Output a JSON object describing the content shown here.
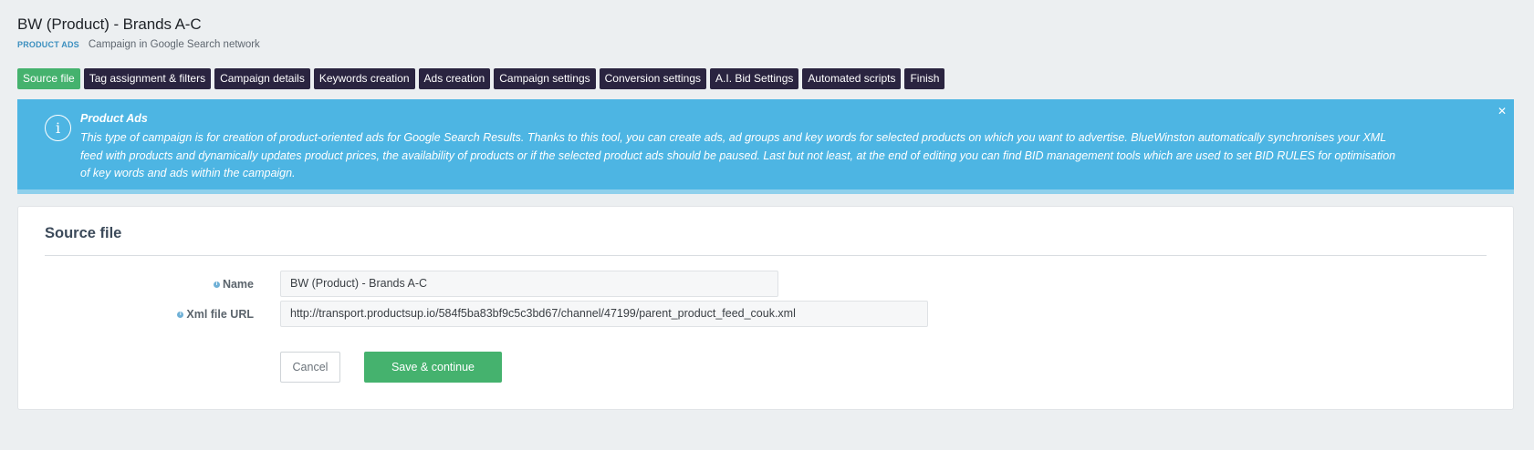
{
  "header": {
    "title": "BW (Product) - Brands A-C",
    "badge": "PRODUCT ADS",
    "subtitle": "Campaign in Google Search network"
  },
  "tabs": [
    {
      "label": "Source file",
      "active": true
    },
    {
      "label": "Tag assignment & filters"
    },
    {
      "label": "Campaign details"
    },
    {
      "label": "Keywords creation"
    },
    {
      "label": "Ads creation"
    },
    {
      "label": "Campaign settings"
    },
    {
      "label": "Conversion settings"
    },
    {
      "label": "A.I. Bid Settings"
    },
    {
      "label": "Automated scripts"
    },
    {
      "label": "Finish"
    }
  ],
  "alert": {
    "icon": "info-icon",
    "title": "Product Ads",
    "text": "This type of campaign is for creation of product-oriented ads for Google Search Results. Thanks to this tool, you can create ads, ad groups and key words for selected products on which you want to advertise. BlueWinston automatically synchronises your XML feed with products and dynamically updates product prices, the availability of products or if the selected product ads should be paused. Last but not least, at the end of editing you can find BID management tools which are used to set BID RULES for optimisation of key words and ads within the campaign.",
    "close": "✕"
  },
  "source_file": {
    "title": "Source file",
    "name_label": "Name",
    "name_value": "BW (Product) - Brands A-C",
    "xml_label": "Xml file URL",
    "xml_value": "http://transport.productsup.io/584f5ba83bf9c5c3bd67/channel/47199/parent_product_feed_couk.xml",
    "cancel_label": "Cancel",
    "save_label": "Save & continue"
  },
  "colors": {
    "accent_green": "#45b26e",
    "tab_dark": "#2a2440",
    "alert_blue": "#4db5e3"
  }
}
